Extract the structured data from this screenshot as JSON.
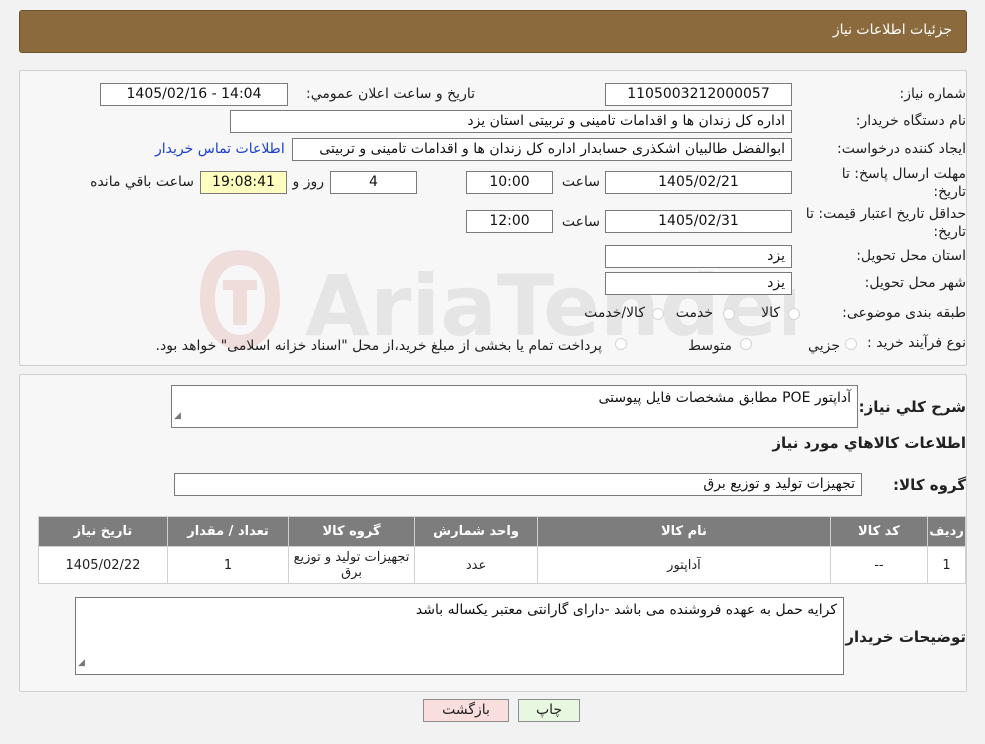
{
  "header": {
    "title": "جزئیات اطلاعات نیاز"
  },
  "info": {
    "need_number_label": "شماره نیاز:",
    "need_number": "1105003212000057",
    "announce_label": "تاريخ و ساعت اعلان عمومي:",
    "announce_value": "1405/02/16 - 14:04",
    "buyer_org_label": "نام دستگاه خريدار:",
    "buyer_org": "اداره کل زندان ها و اقدامات تامینی و تربیتی استان یزد",
    "creator_label": "ايجاد کننده درخواست:",
    "creator": "ابوالفضل  طالبیان اشکذری حسابدار اداره کل زندان ها و اقدامات تامینی و تربیتی",
    "contact_link": "اطلاعات تماس خريدار",
    "deadline_label_1": "مهلت ارسال پاسخ: تا",
    "deadline_label_2": "تاريخ:",
    "deadline_date": "1405/02/21",
    "time_label": "ساعت",
    "deadline_time": "10:00",
    "days_value": "4",
    "days_label": "روز و",
    "remaining_time": "19:08:41",
    "remaining_label": "ساعت باقي مانده",
    "validity_label_1": "حداقل تاريخ اعتبار قيمت: تا",
    "validity_label_2": "تاريخ:",
    "validity_date": "1405/02/31",
    "validity_time": "12:00",
    "province_label": "استان محل تحويل:",
    "province": "یزد",
    "city_label": "شهر محل تحويل:",
    "city": "یزد",
    "category_label": "طبقه بندی موضوعی:",
    "category_options": [
      "کالا",
      "خدمت",
      "کالا/خدمت"
    ],
    "process_label": "نوع فرآيند خريد :",
    "process_options": [
      "جزيي",
      "متوسط"
    ],
    "process_note": "پرداخت تمام یا بخشی از مبلغ خرید،از محل \"اسناد خزانه اسلامی\" خواهد بود."
  },
  "description": {
    "label": "شرح کلي نياز:",
    "value": "آداپتور POE  مطابق مشخصات فایل پیوستی"
  },
  "goods": {
    "section_title": "اطلاعات کالاهاي مورد نياز",
    "group_label": "گروه کالا:",
    "group_value": "تجهیزات تولید و توزیع برق",
    "columns": [
      "رديف",
      "کد کالا",
      "نام کالا",
      "واحد شمارش",
      "گروه کالا",
      "تعداد / مقدار",
      "تاريخ نياز"
    ],
    "rows": [
      [
        "1",
        "--",
        "آداپتور",
        "عدد",
        "تجهیزات تولید و توزیع برق",
        "1",
        "1405/02/22"
      ]
    ]
  },
  "buyer_notes": {
    "label": "توضيحات خريدار:",
    "value": "کرایه حمل به عهده فروشنده می باشد -دارای گارانتی معتبر یکساله باشد"
  },
  "buttons": {
    "print": "چاپ",
    "back": "بازگشت"
  },
  "colors": {
    "header_bg": "#8b6a3e",
    "table_header_bg": "#7d7d7d",
    "print_bg": "#e8f7e0",
    "back_bg": "#f9dede"
  }
}
